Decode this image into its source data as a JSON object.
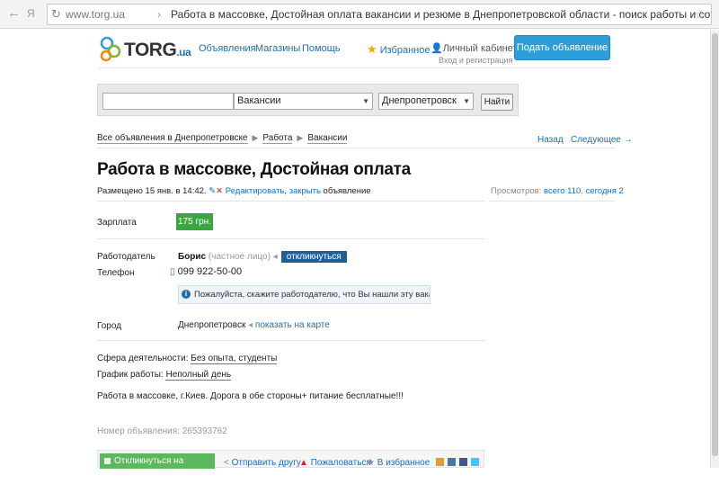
{
  "browser": {
    "url": "www.torg.ua",
    "tab_title": "Работа в массовке, Достойная оплата вакансии и резюме в Днепропетровской области - поиск работы и сотрудников на AVITO.ru"
  },
  "header": {
    "logo_main": "TORG",
    "logo_suffix": ".ua",
    "nav": [
      "Объявления",
      "Магазины",
      "Помощь"
    ],
    "favorites": "Избранное",
    "cabinet": "Личный кабинет",
    "cabinet_sub": "Вход и регистрация",
    "post_ad": "Подать объявление"
  },
  "search": {
    "query": "",
    "category": "Вакансии",
    "city": "Днепропетровск",
    "button": "Найти"
  },
  "breadcrumbs": [
    "Все объявления в Днепропетровске",
    "Работа",
    "Вакансии"
  ],
  "pager": {
    "back": "Назад",
    "next": "Следующее →"
  },
  "ad": {
    "title": "Работа в массовке, Достойная оплата",
    "posted": "Размещено 15 янв. в 14:42.",
    "edit": "Редактировать",
    "close": "закрыть",
    "edit_suffix": "объявление",
    "views_label": "Просмотров:",
    "views_total": "всего 110",
    "views_today": "сегодня 2",
    "salary_label": "Зарплата",
    "salary": "175 грн.",
    "employer_label": "Работодатель",
    "employer": "Борис",
    "employer_type": "(частное лицо)",
    "respond": "откликнуться",
    "phone_label": "Телефон",
    "phone": "099 922-50-00",
    "notice": "Пожалуйста, скажите работодателю, что Вы нашли эту вакансию на ТОРГ",
    "city_label": "Город",
    "city": "Днепропетровск",
    "map_link": "показать на карте",
    "sphere_label": "Сфера деятельности:",
    "sphere": "Без опыта, студенты",
    "schedule_label": "График работы:",
    "schedule": "Неполный день",
    "description": "Работа в массовке, г.Киев. Дорога в обе стороны+ питание бесплатные!!!",
    "ad_number": "Номер объявления: 265393762"
  },
  "actions": {
    "apply": "Откликнуться на вакансию",
    "send": "Отправить другу",
    "complain": "Пожаловаться",
    "favorite": "В избранное"
  },
  "colors": {
    "accent": "#2d9ed9",
    "salary": "#3aa640",
    "link": "#1e6fb0"
  }
}
